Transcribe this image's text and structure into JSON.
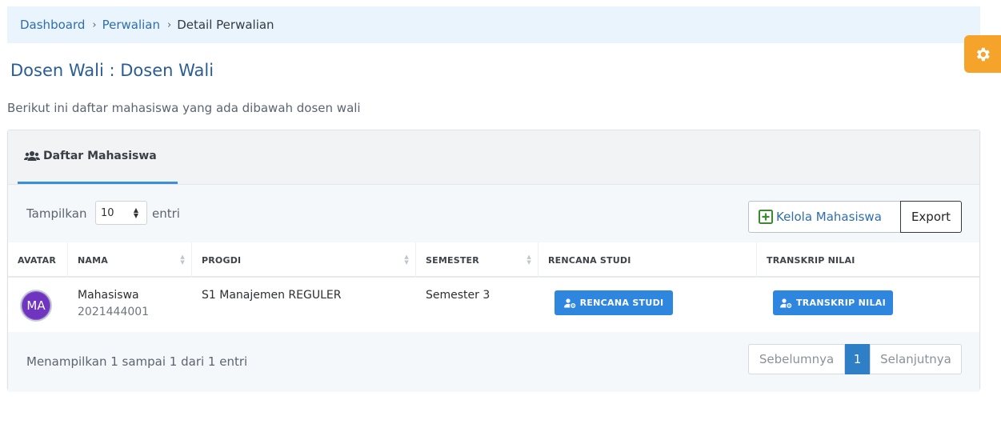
{
  "breadcrumb": {
    "items": [
      {
        "label": "Dashboard"
      },
      {
        "label": "Perwalian"
      },
      {
        "label": "Detail Perwalian"
      }
    ],
    "separator": "›"
  },
  "page": {
    "title": "Dosen Wali : Dosen Wali",
    "description": "Berikut ini daftar mahasiswa yang ada dibawah dosen wali"
  },
  "settings": {
    "icon": "gear-icon",
    "color": "#f6a32b"
  },
  "card": {
    "tab": {
      "label": "Daftar Mahasiswa",
      "icon": "users-icon"
    },
    "length": {
      "prefix": "Tampilkan",
      "value": "10",
      "suffix": "entri"
    },
    "actions": {
      "kelola_label": "Kelola Mahasiswa",
      "kelola_icon": "plus-square-icon",
      "export_label": "Export"
    },
    "table": {
      "columns": [
        "AVATAR",
        "NAMA",
        "PROGDI",
        "SEMESTER",
        "RENCANA STUDI",
        "TRANSKRIP NILAI"
      ],
      "rows": [
        {
          "avatar_initials": "MA",
          "nama": "Mahasiswa",
          "nim": "2021444001",
          "progdi": "S1 Manajemen REGULER",
          "semester": "Semester 3",
          "rencana_label": "RENCANA STUDI",
          "transkrip_label": "TRANSKRIP NILAI"
        }
      ]
    },
    "footer": {
      "info": "Menampilkan 1 sampai 1 dari 1 entri",
      "prev": "Sebelumnya",
      "page": "1",
      "next": "Selanjutnya"
    }
  },
  "colors": {
    "accent": "#2f86de",
    "title": "#2a5d96",
    "avatar": "#6f35c0"
  }
}
